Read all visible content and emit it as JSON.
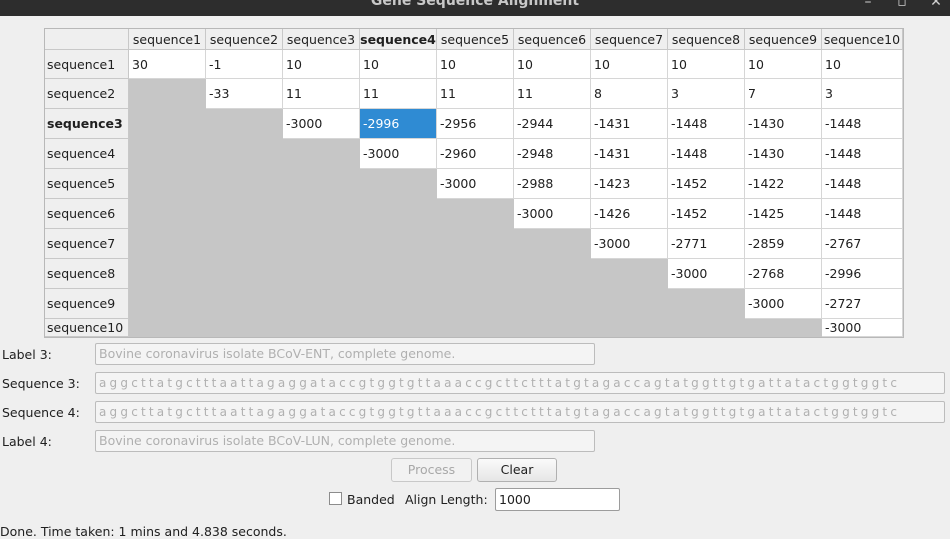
{
  "window": {
    "title": "Gene Sequence Alignment",
    "minimize_glyph": "–",
    "maximize_glyph": "▫",
    "close_glyph": "✕"
  },
  "table": {
    "columns": [
      "sequence1",
      "sequence2",
      "sequence3",
      "sequence4",
      "sequence5",
      "sequence6",
      "sequence7",
      "sequence8",
      "sequence9",
      "sequence10"
    ],
    "rows": [
      "sequence1",
      "sequence2",
      "sequence3",
      "sequence4",
      "sequence5",
      "sequence6",
      "sequence7",
      "sequence8",
      "sequence9",
      "sequence10"
    ],
    "bold_column_index": 3,
    "bold_row_index": 2,
    "selected_cell": [
      2,
      3
    ],
    "cells": [
      [
        "30",
        "-1",
        "10",
        "10",
        "10",
        "10",
        "10",
        "10",
        "10",
        "10"
      ],
      [
        "",
        "-33",
        "11",
        "11",
        "11",
        "11",
        "8",
        "3",
        "7",
        "3"
      ],
      [
        "",
        "",
        "-3000",
        "-2996",
        "-2956",
        "-2944",
        "-1431",
        "-1448",
        "-1430",
        "-1448"
      ],
      [
        "",
        "",
        "",
        "-3000",
        "-2960",
        "-2948",
        "-1431",
        "-1448",
        "-1430",
        "-1448"
      ],
      [
        "",
        "",
        "",
        "",
        "-3000",
        "-2988",
        "-1423",
        "-1452",
        "-1422",
        "-1448"
      ],
      [
        "",
        "",
        "",
        "",
        "",
        "-3000",
        "-1426",
        "-1452",
        "-1425",
        "-1448"
      ],
      [
        "",
        "",
        "",
        "",
        "",
        "",
        "-3000",
        "-2771",
        "-2859",
        "-2767"
      ],
      [
        "",
        "",
        "",
        "",
        "",
        "",
        "",
        "-3000",
        "-2768",
        "-2996"
      ],
      [
        "",
        "",
        "",
        "",
        "",
        "",
        "",
        "",
        "-3000",
        "-2727"
      ],
      [
        "",
        "",
        "",
        "",
        "",
        "",
        "",
        "",
        "",
        "-3000"
      ]
    ]
  },
  "form": {
    "label3_label": "Label 3:",
    "label3_value": "Bovine coronavirus isolate BCoV-ENT, complete genome.",
    "sequence3_label": "Sequence 3:",
    "sequence3_value": "aggcttatgctttaattagaggataccgtggtgttaaaccgcttctttatgtagaccagtatggttgtgattatactggtggtc",
    "sequence4_label": "Sequence 4:",
    "sequence4_value": "aggcttatgctttaattagaggataccgtggtgttaaaccgcttctttatgtagaccagtatggttgtgattatactggtggtc",
    "label4_label": "Label 4:",
    "label4_value": "Bovine coronavirus isolate BCoV-LUN, complete genome."
  },
  "buttons": {
    "process": "Process",
    "clear": "Clear"
  },
  "options": {
    "banded_label": "Banded",
    "banded_checked": false,
    "align_length_label": "Align Length:",
    "align_length_value": "1000"
  },
  "status": {
    "text": "Done.  Time taken: 1 mins and 4.838 seconds."
  }
}
